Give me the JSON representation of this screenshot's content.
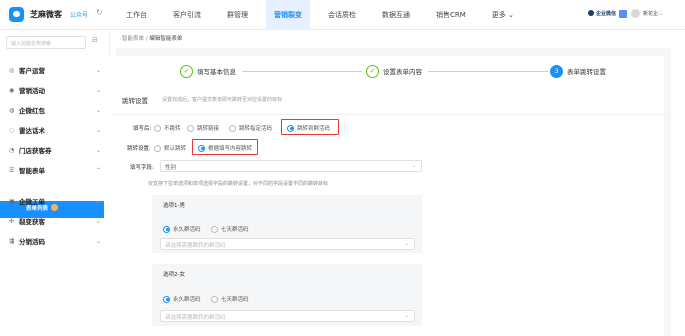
{
  "header": {
    "brand": "芝麻微客",
    "account": "公众号",
    "nav": [
      "工作台",
      "客户引流",
      "群管理",
      "营销裂变",
      "会话质检",
      "数据互通",
      "销售CRM",
      "更多 ⌄"
    ],
    "active_nav": "营销裂变",
    "brand_mini": "企业微信",
    "user": "新花企..."
  },
  "sidebar": {
    "search_placeholder": "输入功能名称搜索",
    "items": [
      {
        "label": "客户运营",
        "icon": "user-icon"
      },
      {
        "label": "营销活动",
        "icon": "target-icon"
      },
      {
        "label": "企微红包",
        "icon": "redpacket-icon"
      },
      {
        "label": "雷达话术",
        "icon": "radar-icon"
      },
      {
        "label": "门店获客券",
        "icon": "store-icon"
      },
      {
        "label": "智能表单",
        "icon": "form-icon"
      },
      {
        "label": "企微工单",
        "icon": "ticket-icon"
      },
      {
        "label": "裂变获客",
        "icon": "share-icon"
      },
      {
        "label": "分销活码",
        "icon": "code-icon"
      }
    ],
    "active_sub": "表单列表"
  },
  "breadcrumb": [
    "智能表单",
    "编辑智能表单"
  ],
  "steps": [
    {
      "label": "填写基本信息",
      "state": "done",
      "mark": "✓"
    },
    {
      "label": "设置表单内容",
      "state": "done",
      "mark": "✓"
    },
    {
      "label": "表单跳转设置",
      "state": "active",
      "mark": "3"
    }
  ],
  "section": {
    "title": "跳转设置",
    "desc": "设置完成后，客户提交表单即可跳转至对应设置的目标"
  },
  "form": {
    "fill_after_label": "填写后:",
    "fill_after_options": [
      "不跳转",
      "跳转链接",
      "跳转指定活码",
      "跳转到群活码"
    ],
    "fill_after_selected": "跳转到群活码",
    "jump_setting_label": "跳转设置:",
    "jump_setting_options": [
      "默认跳转",
      "根据填写内容跳转"
    ],
    "jump_setting_selected": "根据填写内容跳转",
    "field_label": "填写字段:",
    "field_value": "性别",
    "note": "仅支持下拉单选项和单项选择字段的跳转设置，对不同的字段设置不同的跳转目标",
    "options": [
      {
        "title": "选项1-男",
        "radios": [
          "永久群活码",
          "七天群活码"
        ],
        "selected": "永久群活码",
        "placeholder": "请选择需要跳转的群活码"
      },
      {
        "title": "选项2-女",
        "radios": [
          "永久群活码",
          "七天群活码"
        ],
        "selected": "永久群活码",
        "placeholder": "请选择需要跳转的群活码"
      }
    ]
  },
  "colors": {
    "primary": "#1890ff",
    "success": "#52c41a",
    "highlight": "#e53935"
  }
}
